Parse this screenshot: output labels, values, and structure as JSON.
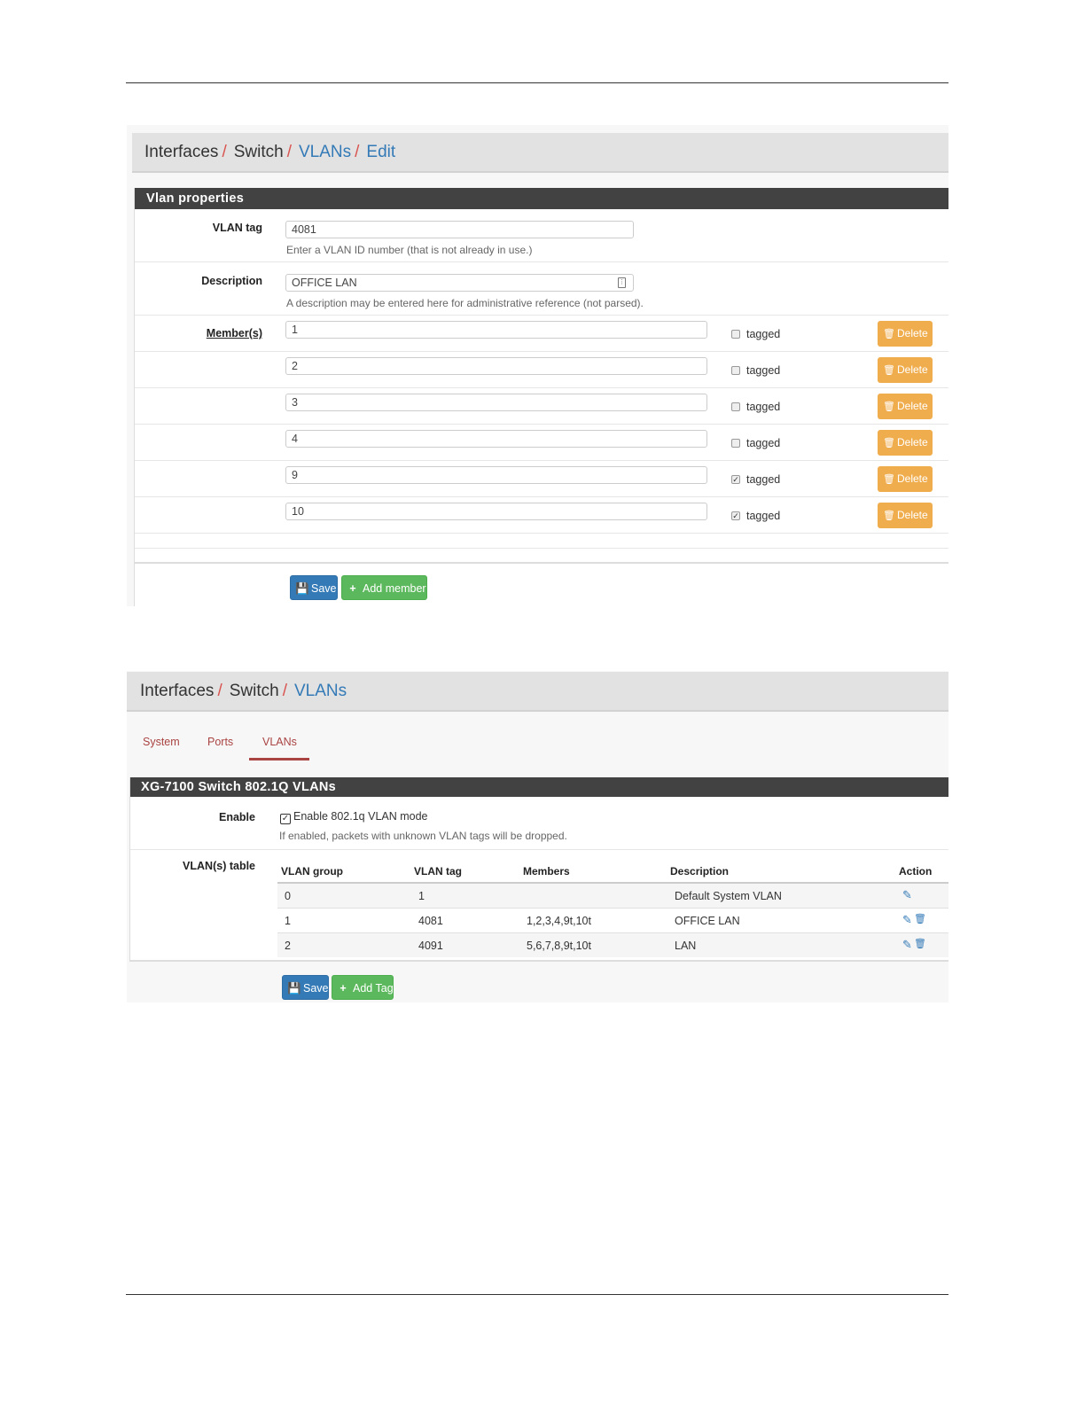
{
  "shot1": {
    "breadcrumb": [
      {
        "label": "Interfaces",
        "link": false
      },
      {
        "label": "Switch",
        "link": false
      },
      {
        "label": "VLANs",
        "link": true
      },
      {
        "label": "Edit",
        "link": true
      }
    ],
    "separator": "/",
    "panel_title": "Vlan properties",
    "vlan_tag": {
      "label": "VLAN tag",
      "value": "4081",
      "hint": "Enter a VLAN ID number (that is not already in use.)"
    },
    "description": {
      "label": "Description",
      "value": "OFFICE LAN",
      "hint": "A description may be entered here for administrative reference (not parsed)."
    },
    "members_label": "Member(s)",
    "members": [
      {
        "value": "1",
        "tagged": false
      },
      {
        "value": "2",
        "tagged": false
      },
      {
        "value": "3",
        "tagged": false
      },
      {
        "value": "4",
        "tagged": false
      },
      {
        "value": "9",
        "tagged": true
      },
      {
        "value": "10",
        "tagged": true
      }
    ],
    "tagged_label": "tagged",
    "delete_label": "Delete",
    "save_label": "Save",
    "add_member_label": "Add member"
  },
  "shot2": {
    "breadcrumb": [
      {
        "label": "Interfaces",
        "link": false
      },
      {
        "label": "Switch",
        "link": false
      },
      {
        "label": "VLANs",
        "link": true
      }
    ],
    "separator": "/",
    "tabs": [
      "System",
      "Ports",
      "VLANs"
    ],
    "active_tab": "VLANs",
    "panel_title": "XG-7100 Switch 802.1Q VLANs",
    "enable": {
      "label": "Enable",
      "checkbox_label": "Enable 802.1q VLAN mode",
      "checked": true,
      "hint": "If enabled, packets with unknown VLAN tags will be dropped."
    },
    "table_label": "VLAN(s) table",
    "columns": [
      "VLAN group",
      "VLAN tag",
      "Members",
      "Description",
      "Action"
    ],
    "rows": [
      {
        "group": "0",
        "tag": "1",
        "members": "",
        "description": "Default System VLAN",
        "actions": [
          "pencil-icon"
        ]
      },
      {
        "group": "1",
        "tag": "4081",
        "members": "1,2,3,4,9t,10t",
        "description": "OFFICE LAN",
        "actions": [
          "pencil-icon",
          "trash-icon"
        ]
      },
      {
        "group": "2",
        "tag": "4091",
        "members": "5,6,7,8,9t,10t",
        "description": "LAN",
        "actions": [
          "pencil-icon",
          "trash-icon"
        ]
      }
    ],
    "save_label": "Save",
    "add_tag_label": "Add Tag"
  },
  "colors": {
    "link": "#337ab7",
    "separator": "#d9534f",
    "panel_head": "#424242",
    "delete": "#f0ad4e",
    "save": "#337ab7",
    "add": "#5cb85c",
    "tab": "#a94442"
  }
}
